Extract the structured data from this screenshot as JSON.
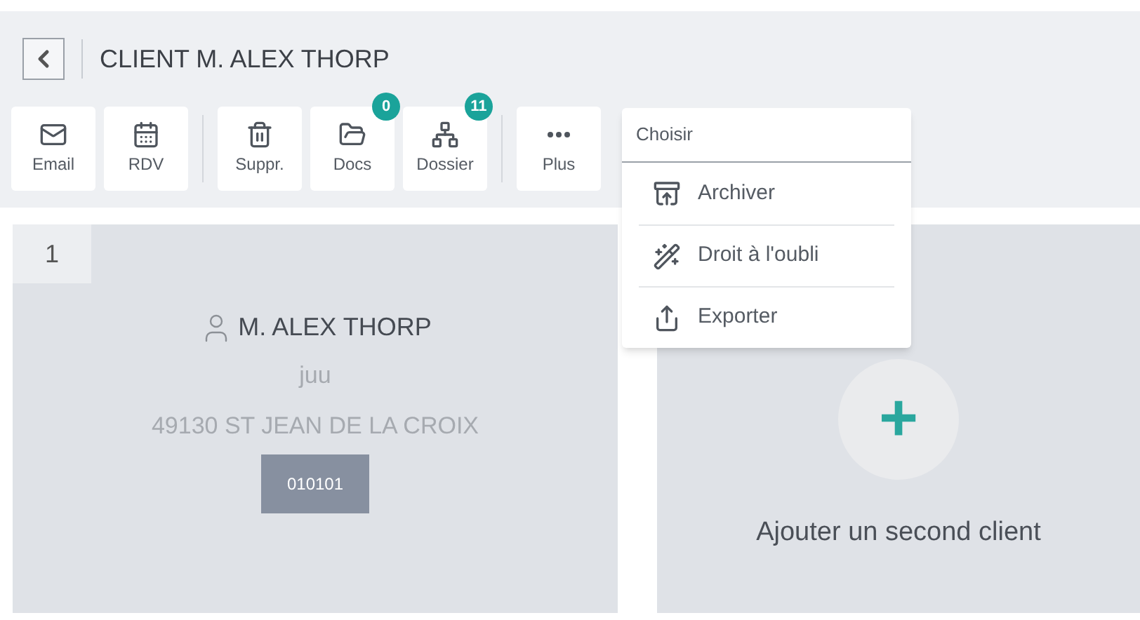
{
  "header": {
    "title": "CLIENT M. ALEX THORP"
  },
  "toolbar": [
    [
      {
        "label": "Email"
      },
      {
        "label": "RDV"
      }
    ],
    [
      {
        "label": "Suppr."
      },
      {
        "label": "Docs",
        "badge": "0"
      },
      {
        "label": "Dossier",
        "badge": "11"
      }
    ],
    [
      {
        "label": "Plus"
      }
    ]
  ],
  "menu": {
    "title": "Choisir",
    "items": [
      "Archiver",
      "Droit à l'oubli",
      "Exporter"
    ]
  },
  "client_card": {
    "number": "1",
    "name": "M. ALEX THORP",
    "line_2": "juu",
    "address": "49130 ST JEAN DE LA CROIX",
    "code": "010101"
  },
  "add_card": {
    "symbol": "+",
    "label": "Ajouter un second client"
  }
}
